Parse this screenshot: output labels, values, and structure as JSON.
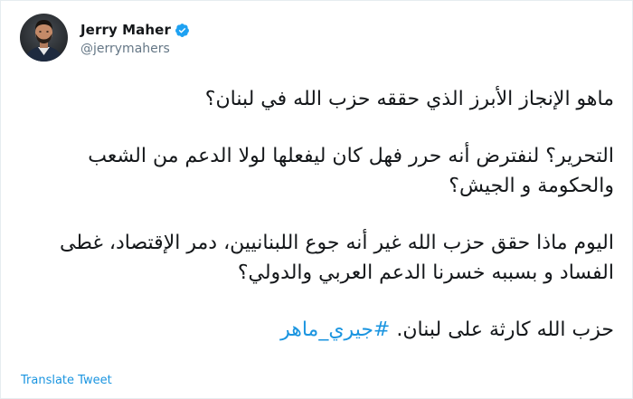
{
  "user": {
    "display_name": "Jerry Maher",
    "handle": "@jerrymahers",
    "verified_badge_color": "#1da1f2"
  },
  "tweet": {
    "paragraphs": [
      {
        "text": "ماهو الإنجاز الأبرز الذي حققه حزب الله في لبنان؟"
      },
      {
        "text": "التحرير؟ لنفترض أنه حرر فهل كان ليفعلها لولا الدعم من الشعب والحكومة و الجيش؟"
      },
      {
        "text": "اليوم ماذا حقق حزب الله غير أنه جوع اللبنانيين، دمر الإقتصاد، غطى الفساد و بسببه خسرنا الدعم العربي والدولي؟"
      }
    ],
    "last_line_text": "حزب الله كارثة على لبنان.",
    "hashtag": "#جيري_ماهر",
    "hashtag_color": "#1b95e0"
  },
  "actions": {
    "translate_label": "Translate Tweet"
  },
  "icons": {
    "verified": "verified-badge-icon",
    "avatar": "profile-photo"
  }
}
